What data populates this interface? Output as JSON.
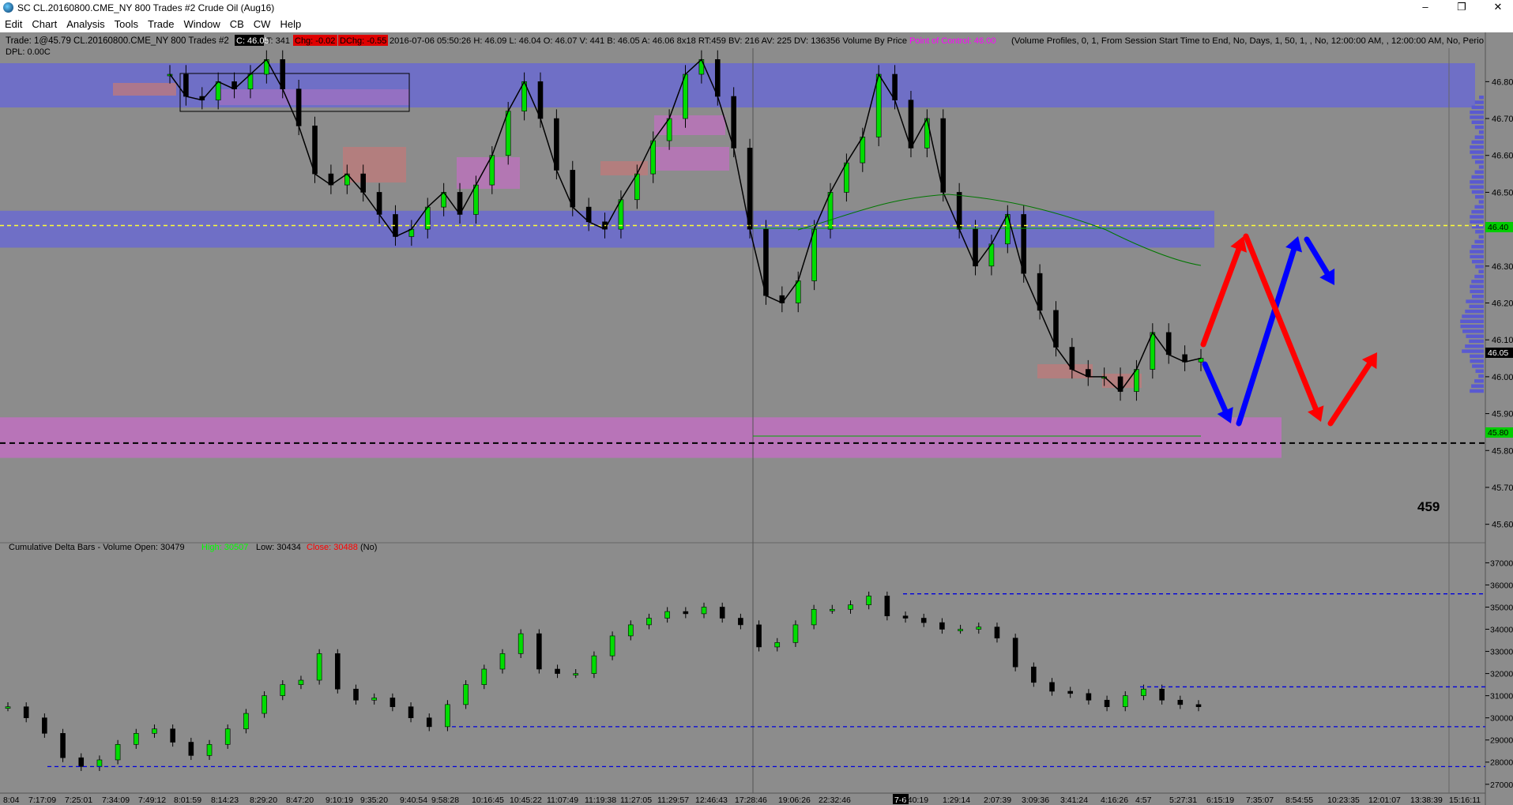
{
  "window": {
    "title": "SC CL.20160800.CME_NY  800 Trades  #2  Crude Oil (Aug16)",
    "minimize": "–",
    "restore": "❐",
    "close": "✕"
  },
  "menu": [
    "Edit",
    "Chart",
    "Analysis",
    "Tools",
    "Trade",
    "Window",
    "CB",
    "CW",
    "Help"
  ],
  "header": {
    "line1_prefix": "Trade: 1@45.79  CL.20160800.CME_NY  800 Trades  #2",
    "c_badge": "C: 46.05",
    "t_count": "T: 341",
    "chg_badge": "Chg: -0.02",
    "dchg_badge": "DChg: -0.55",
    "line1_stats": "2016-07-06 05:50:26  H: 46.09  L: 46.04  O: 46.07  V: 441  B: 46.05  A: 46.06  8x18  RT:459  BV: 216  AV: 225  DV: 136356  Volume By Price",
    "poc_label": "Point of Control: 46.00",
    "line1_tail": "(Volume Profiles, 0, 1, From Session Start Time to End, No, Days, 1, 50, 1, , No, 12:00:00 AM, , 12:00:00 AM, No, Perio",
    "line2": "DPL: 0.00C",
    "colors": {
      "badge_bg": "#000",
      "badge_fg": "#fff",
      "chg_bg": "#e00000",
      "poc": "#ff00ff"
    }
  },
  "price_panel": {
    "y_ticks": [
      "46.80",
      "46.70",
      "46.60",
      "46.50",
      "46.40",
      "46.30",
      "46.20",
      "46.10",
      "46.00",
      "45.90",
      "45.80",
      "45.70",
      "45.60"
    ],
    "last_price_badge": "46.05",
    "green_badge_top": "46.40",
    "green_badge_bottom": "45.80",
    "counter": "459"
  },
  "delta_panel": {
    "header_prefix": "Cumulative Delta Bars - Volume  Open: 30479",
    "high_label": "High: 30507",
    "low_label": "Low: 30434",
    "close_label": "Close: 30488",
    "header_tail": "(No)",
    "y_ticks": [
      "37000",
      "36000",
      "35000",
      "34000",
      "33000",
      "32000",
      "31000",
      "30000",
      "29000",
      "28000",
      "27000"
    ],
    "colors": {
      "high": "#00ff00",
      "close": "#ff0000"
    }
  },
  "x_axis": {
    "labels": [
      "8:04",
      "7:17:09",
      "7:25:01",
      "7:34:09",
      "7:49:12",
      "8:01:59",
      "8:14:23",
      "8:29:20",
      "8:47:20",
      "9:10:19",
      "9:35:20",
      "9:40:54",
      "9:58:28",
      "10:16:45",
      "10:45:22",
      "11:07:49",
      "11:19:38",
      "11:27:05",
      "11:29:57",
      "12:46:43",
      "17:28:46",
      "19:06:26",
      "22:32:46",
      "7-6",
      "0:40:19",
      "1:29:14",
      "2:07:39",
      "3:09:36",
      "3:41:24",
      "4:16:26",
      "4:57",
      "5:27:31",
      "6:15:19",
      "7:35:07",
      "8:54:55",
      "10:23:35",
      "12:01:07",
      "13:38:39",
      "15:16:11"
    ]
  },
  "chart_data": [
    {
      "type": "candlestick",
      "title": "Crude Oil (Aug16) 800 Trades",
      "ylim": [
        45.55,
        46.88
      ],
      "close_path": [
        46.82,
        46.76,
        46.75,
        46.8,
        46.78,
        46.82,
        46.86,
        46.78,
        46.68,
        46.55,
        46.52,
        46.55,
        46.5,
        46.44,
        46.38,
        46.4,
        46.46,
        46.5,
        46.44,
        46.52,
        46.6,
        46.72,
        46.8,
        46.7,
        46.56,
        46.46,
        46.42,
        46.4,
        46.48,
        46.55,
        46.64,
        46.7,
        46.82,
        46.86,
        46.76,
        46.62,
        46.4,
        46.22,
        46.2,
        46.26,
        46.4,
        46.5,
        46.58,
        46.65,
        46.82,
        46.75,
        46.62,
        46.7,
        46.5,
        46.4,
        46.3,
        46.36,
        46.44,
        46.28,
        46.18,
        46.08,
        46.02,
        46.0,
        46.0,
        45.96,
        46.02,
        46.12,
        46.06,
        46.04,
        46.05
      ],
      "reference_lines": [
        {
          "label": "yellow dashed",
          "value": 46.41,
          "color": "#ffff33"
        },
        {
          "label": "black dashed",
          "value": 45.82,
          "color": "#000000"
        }
      ],
      "zones": [
        {
          "color": "#6a6ad0",
          "from": 46.73,
          "to": 46.85
        },
        {
          "color": "#6a6ad0",
          "from": 46.35,
          "to": 46.45
        },
        {
          "color": "#c070c0",
          "from": 45.78,
          "to": 45.89
        }
      ],
      "projection_arrows": [
        "red up",
        "blue down",
        "blue up",
        "red down",
        "blue down",
        "red up"
      ]
    },
    {
      "type": "candlestick",
      "title": "Cumulative Delta Bars - Volume",
      "ylim": [
        26600,
        37300
      ],
      "close_path": [
        30500,
        30000,
        29300,
        28200,
        27800,
        28100,
        28800,
        29300,
        29500,
        28900,
        28300,
        28800,
        29500,
        30200,
        31000,
        31500,
        31700,
        32900,
        31300,
        30800,
        30900,
        30500,
        30000,
        29600,
        30600,
        31500,
        32200,
        32900,
        33800,
        32200,
        32000,
        32000,
        32800,
        33700,
        34200,
        34500,
        34800,
        34700,
        35000,
        34500,
        34200,
        33200,
        33400,
        34200,
        34900,
        34900,
        35100,
        35500,
        34600,
        34500,
        34300,
        34000,
        34000,
        34100,
        33600,
        32300,
        31600,
        31200,
        31100,
        30800,
        30500,
        31000,
        31300,
        30800,
        30600,
        30500
      ],
      "reference_lines": [
        35600,
        31400,
        29600,
        27800
      ]
    }
  ]
}
